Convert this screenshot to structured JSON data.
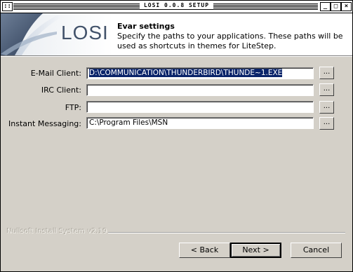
{
  "window": {
    "title": "LOSI 0.0.8 SETUP",
    "menu_glyph": "::",
    "min_glyph": "_",
    "max_glyph": "□",
    "close_glyph": "×"
  },
  "header": {
    "logo": "LOSI",
    "title": "Evar settings",
    "description": "Specify the paths to your applications. These paths will be used as shortcuts in themes for LiteStep."
  },
  "fields": [
    {
      "label": "E-Mail Client:",
      "value": "D:\\COMMUNICATION\\THUNDERBIRD\\THUNDE~1.EXE"
    },
    {
      "label": "IRC Client:",
      "value": ""
    },
    {
      "label": "FTP:",
      "value": ""
    },
    {
      "label": "Instant Messaging:",
      "value": "C:\\Program Files\\MSN"
    }
  ],
  "browse_label": "...",
  "footer": {
    "branding": "Nullsoft Install System v2.19",
    "back_label": "< Back",
    "next_label": "Next >",
    "cancel_label": "Cancel"
  }
}
